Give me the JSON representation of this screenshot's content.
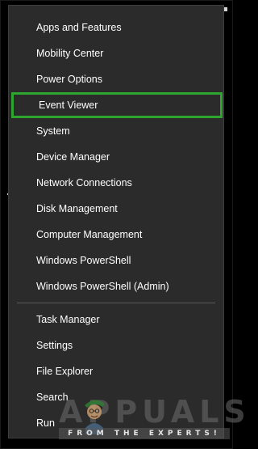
{
  "menu": {
    "items": [
      {
        "label": "Apps and Features",
        "highlighted": false
      },
      {
        "label": "Mobility Center",
        "highlighted": false
      },
      {
        "label": "Power Options",
        "highlighted": false
      },
      {
        "label": "Event Viewer",
        "highlighted": true
      },
      {
        "label": "System",
        "highlighted": false
      },
      {
        "label": "Device Manager",
        "highlighted": false
      },
      {
        "label": "Network Connections",
        "highlighted": false
      },
      {
        "label": "Disk Management",
        "highlighted": false
      },
      {
        "label": "Computer Management",
        "highlighted": false
      },
      {
        "label": "Windows PowerShell",
        "highlighted": false
      },
      {
        "label": "Windows PowerShell (Admin)",
        "highlighted": false
      },
      {
        "label": "Task Manager",
        "highlighted": false
      },
      {
        "label": "Settings",
        "highlighted": false
      },
      {
        "label": "File Explorer",
        "highlighted": false
      },
      {
        "label": "Search",
        "highlighted": false
      },
      {
        "label": "Run",
        "highlighted": false
      }
    ]
  },
  "watermark": {
    "logo": "APPUALS",
    "tagline": "FROM THE EXPERTS!"
  },
  "colors": {
    "menu_background": "#2b2b2b",
    "highlight_border": "#2ea52e",
    "text": "#ffffff"
  }
}
